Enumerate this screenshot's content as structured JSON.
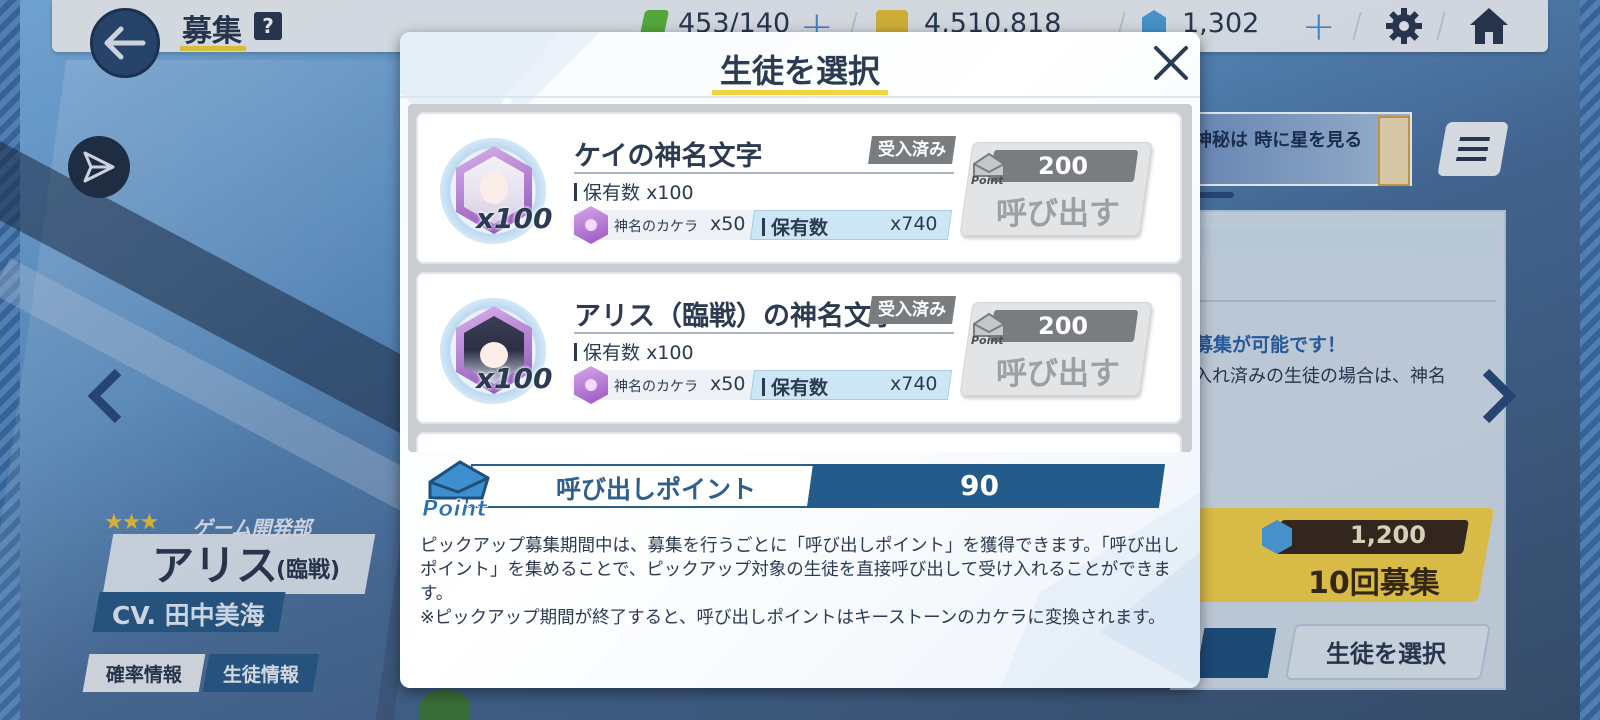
{
  "header": {
    "title": "募集",
    "help_icon": "?",
    "ap_value": "453/140",
    "credits_value": "4,510,818",
    "pyroxene_value": "1,302",
    "plus_symbol": "+"
  },
  "character": {
    "stars": "★★★",
    "club": "ゲーム開発部",
    "name": "アリス",
    "variant": "(臨戦)",
    "cv": "CV. 田中美海",
    "rate_button": "確率情報",
    "info_button": "生徒情報"
  },
  "right_panel": {
    "notice_blue": "募集が可能です！",
    "notice_text": "入れ済みの生徒の場合は、神名",
    "banner_text": "神秘は 時に星を見る",
    "ten_pull_price": "1,200",
    "ten_pull_label": "10回募集",
    "select_student_button": "生徒を選択",
    "badge_count": "10"
  },
  "modal": {
    "title": "生徒を選択",
    "items": [
      {
        "name": "ケイの神名文字",
        "status": "受入済み",
        "avatar_qty": "x100",
        "owned_label": "保有数",
        "owned_qty": "x100",
        "kamera_label": "神名のカケラ",
        "kamera_qty": "x50",
        "kamera_owned_label": "保有数",
        "kamera_owned_qty": "x740",
        "point_icon_label": "Point",
        "cost": "200",
        "button_label": "呼び出す"
      },
      {
        "name": "アリス（臨戦）の神名文字",
        "status": "受入済み",
        "avatar_qty": "x100",
        "owned_label": "保有数",
        "owned_qty": "x100",
        "kamera_label": "神名のカケラ",
        "kamera_qty": "x50",
        "kamera_owned_label": "保有数",
        "kamera_owned_qty": "x740",
        "point_icon_label": "Point",
        "cost": "200",
        "button_label": "呼び出す"
      }
    ],
    "points": {
      "icon_label": "Point",
      "label": "呼び出しポイント",
      "value": "90"
    },
    "description": [
      "ピックアップ募集期間中は、募集を行うごとに「呼び出しポイント」を獲得できます。「呼び出しポイント」を集めることで、ピックアップ対象の生徒を直接呼び出して受け入れることができます。",
      "※ピックアップ期間が終了すると、呼び出しポイントはキーストーンのカケラに変換されます。"
    ]
  },
  "colors": {
    "accent_yellow": "#f3d43e",
    "navy": "#2b3b52",
    "blue": "#235c8a",
    "badge_gray": "#7a7d80"
  },
  "icons": [
    "back-arrow-icon",
    "help-icon",
    "ap-icon",
    "credit-icon",
    "pyroxene-icon",
    "gear-icon",
    "home-icon",
    "share-icon",
    "close-icon",
    "point-envelope-icon",
    "kamera-icon",
    "menu-icon",
    "chevron-left-icon",
    "chevron-right-icon"
  ]
}
